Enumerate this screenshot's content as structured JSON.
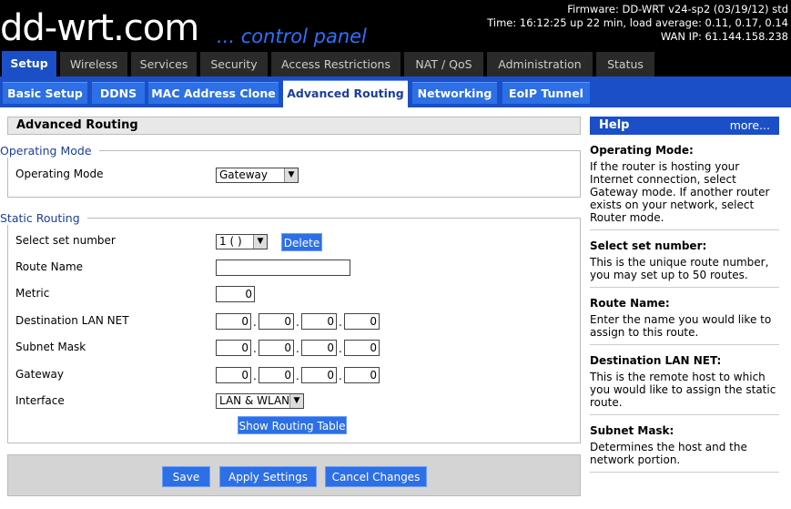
{
  "header": {
    "logo_main": "dd",
    "logo_dash": "-",
    "logo_wrt": "wrt",
    "logo_com": ".com",
    "subtitle": "... control panel",
    "firmware": "Firmware: DD-WRT v24-sp2 (03/19/12) std",
    "time": "Time: 16:12:25 up 22 min, load average: 0.11, 0.17, 0.14",
    "wan_ip": "WAN IP: 61.144.158.238"
  },
  "main_tabs": [
    {
      "label": "Setup",
      "active": true
    },
    {
      "label": "Wireless"
    },
    {
      "label": "Services"
    },
    {
      "label": "Security"
    },
    {
      "label": "Access Restrictions"
    },
    {
      "label": "NAT / QoS"
    },
    {
      "label": "Administration"
    },
    {
      "label": "Status"
    }
  ],
  "sub_tabs": [
    {
      "label": "Basic Setup"
    },
    {
      "label": "DDNS"
    },
    {
      "label": "MAC Address Clone"
    },
    {
      "label": "Advanced Routing",
      "active": true
    },
    {
      "label": "Networking"
    },
    {
      "label": "EoIP Tunnel"
    }
  ],
  "section_title": "Advanced Routing",
  "operating_mode": {
    "legend": "Operating Mode",
    "label": "Operating Mode",
    "value": "Gateway"
  },
  "static_routing": {
    "legend": "Static Routing",
    "set_number_label": "Select set number",
    "set_number_value": "1 ( )",
    "delete_label": "Delete",
    "route_name_label": "Route Name",
    "route_name_value": "",
    "metric_label": "Metric",
    "metric_value": "0",
    "dest_label": "Destination LAN NET",
    "dest": [
      "0",
      "0",
      "0",
      "0"
    ],
    "subnet_label": "Subnet Mask",
    "subnet": [
      "0",
      "0",
      "0",
      "0"
    ],
    "gateway_label": "Gateway",
    "gateway": [
      "0",
      "0",
      "0",
      "0"
    ],
    "interface_label": "Interface",
    "interface_value": "LAN & WLAN",
    "show_table_label": "Show Routing Table"
  },
  "buttons": {
    "save": "Save",
    "apply": "Apply Settings",
    "cancel": "Cancel Changes"
  },
  "help": {
    "title": "Help",
    "more": "more...",
    "items": [
      {
        "title": "Operating Mode:",
        "text": "If the router is hosting your Internet connection, select Gateway mode. If another router exists on your network, select Router mode."
      },
      {
        "title": "Select set number:",
        "text": "This is the unique route number, you may set up to 50 routes."
      },
      {
        "title": "Route Name:",
        "text": "Enter the name you would like to assign to this route."
      },
      {
        "title": "Destination LAN NET:",
        "text": "This is the remote host to which you would like to assign the static route."
      },
      {
        "title": "Subnet Mask:",
        "text": "Determines the host and the network portion."
      }
    ]
  },
  "colors": {
    "accent": "#1a4fc7",
    "subtab": "#2d6fe5",
    "legend": "#1a3d9e"
  }
}
